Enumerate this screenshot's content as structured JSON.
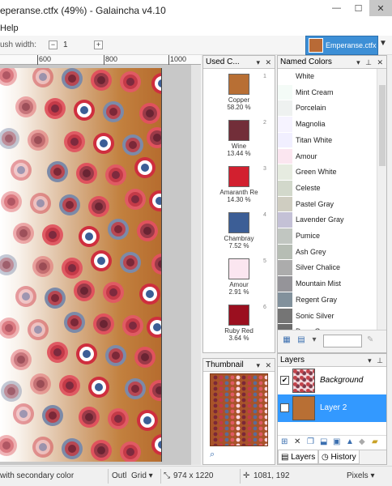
{
  "window": {
    "title": "eperanse.ctfx (49%) - Galaincha v4.10",
    "min_label": "—",
    "max_label": "☐",
    "close_label": "✕"
  },
  "menu": {
    "help": "Help"
  },
  "toolbar": {
    "brush_width_label": "ush width:",
    "brush_width_value": "1",
    "minus": "−",
    "plus": "+",
    "material_label": "Emperanse.ctfx",
    "dropdown": "▼"
  },
  "ruler": {
    "ticks": [
      "600",
      "800",
      "1000"
    ]
  },
  "used_colors": {
    "title": "Used C...",
    "buttons": "▾ ✕",
    "items": [
      {
        "idx": "1",
        "name": "Copper",
        "pct": "58.20 %",
        "color": "#b86f34"
      },
      {
        "idx": "2",
        "name": "Wine",
        "pct": "13.44 %",
        "color": "#722e39"
      },
      {
        "idx": "3",
        "name": "Amaranth Re",
        "pct": "14.30 %",
        "color": "#d2202f"
      },
      {
        "idx": "4",
        "name": "Chambray",
        "pct": "7.52 %",
        "color": "#3c5e96"
      },
      {
        "idx": "5",
        "name": "Amour",
        "pct": "2.91 %",
        "color": "#fbe6f0"
      },
      {
        "idx": "6",
        "name": "Ruby Red",
        "pct": "3.64 %",
        "color": "#9b0f1f"
      }
    ]
  },
  "named_colors": {
    "title": "Named Colors",
    "buttons": "▾ ⊥ ✕",
    "items": [
      {
        "name": "White",
        "color": "#ffffff"
      },
      {
        "name": "Mint Cream",
        "color": "#f4fbf7"
      },
      {
        "name": "Porcelain",
        "color": "#eef1f0"
      },
      {
        "name": "Magnolia",
        "color": "#f6f3ff"
      },
      {
        "name": "Titan White",
        "color": "#f1efff"
      },
      {
        "name": "Amour",
        "color": "#fbe6f0"
      },
      {
        "name": "Green White",
        "color": "#e6ebe0"
      },
      {
        "name": "Celeste",
        "color": "#d2d8cb"
      },
      {
        "name": "Pastel Gray",
        "color": "#cfcdc1"
      },
      {
        "name": "Lavender Gray",
        "color": "#c4c1d6"
      },
      {
        "name": "Pumice",
        "color": "#c1c6c1"
      },
      {
        "name": "Ash Grey",
        "color": "#b6bdb4"
      },
      {
        "name": "Silver Chalice",
        "color": "#acacac"
      },
      {
        "name": "Mountain Mist",
        "color": "#959499"
      },
      {
        "name": "Regent Gray",
        "color": "#82919c"
      },
      {
        "name": "Sonic Silver",
        "color": "#757575"
      },
      {
        "name": "Dove Gray",
        "color": "#6b6b6b"
      }
    ]
  },
  "thumbnail": {
    "title": "Thumbnail",
    "buttons": "▾ ✕"
  },
  "layers": {
    "title": "Layers",
    "buttons": "▾ ⊥",
    "items": [
      {
        "name": "Background",
        "checked": "✔"
      },
      {
        "name": "Layer 2",
        "checked": "✔"
      }
    ],
    "tab_layers": "Layers",
    "tab_history": "History"
  },
  "status": {
    "hint": "with secondary color",
    "outline": "Outl",
    "grid": "Grid ▾",
    "size": "974 x 1220",
    "coords": "1081, 192",
    "units": "Pixels ▾"
  }
}
